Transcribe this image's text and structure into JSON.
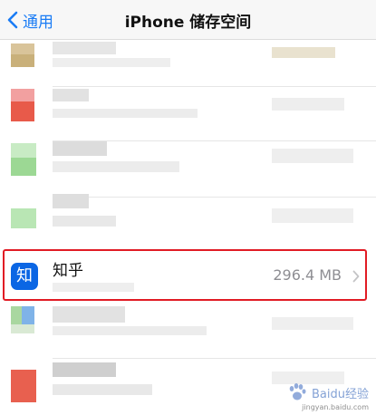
{
  "nav": {
    "back_label": "通用",
    "title": "iPhone 储存空间"
  },
  "highlighted_app": {
    "icon_char": "知",
    "name": "知乎",
    "size": "296.4 MB"
  },
  "watermark": {
    "brand": "Baidu经验",
    "url": "jingyan.baidu.com"
  },
  "colors": {
    "accent": "#1a7cf5",
    "highlight_border": "#e11b24",
    "app_icon": "#0b66e4"
  }
}
